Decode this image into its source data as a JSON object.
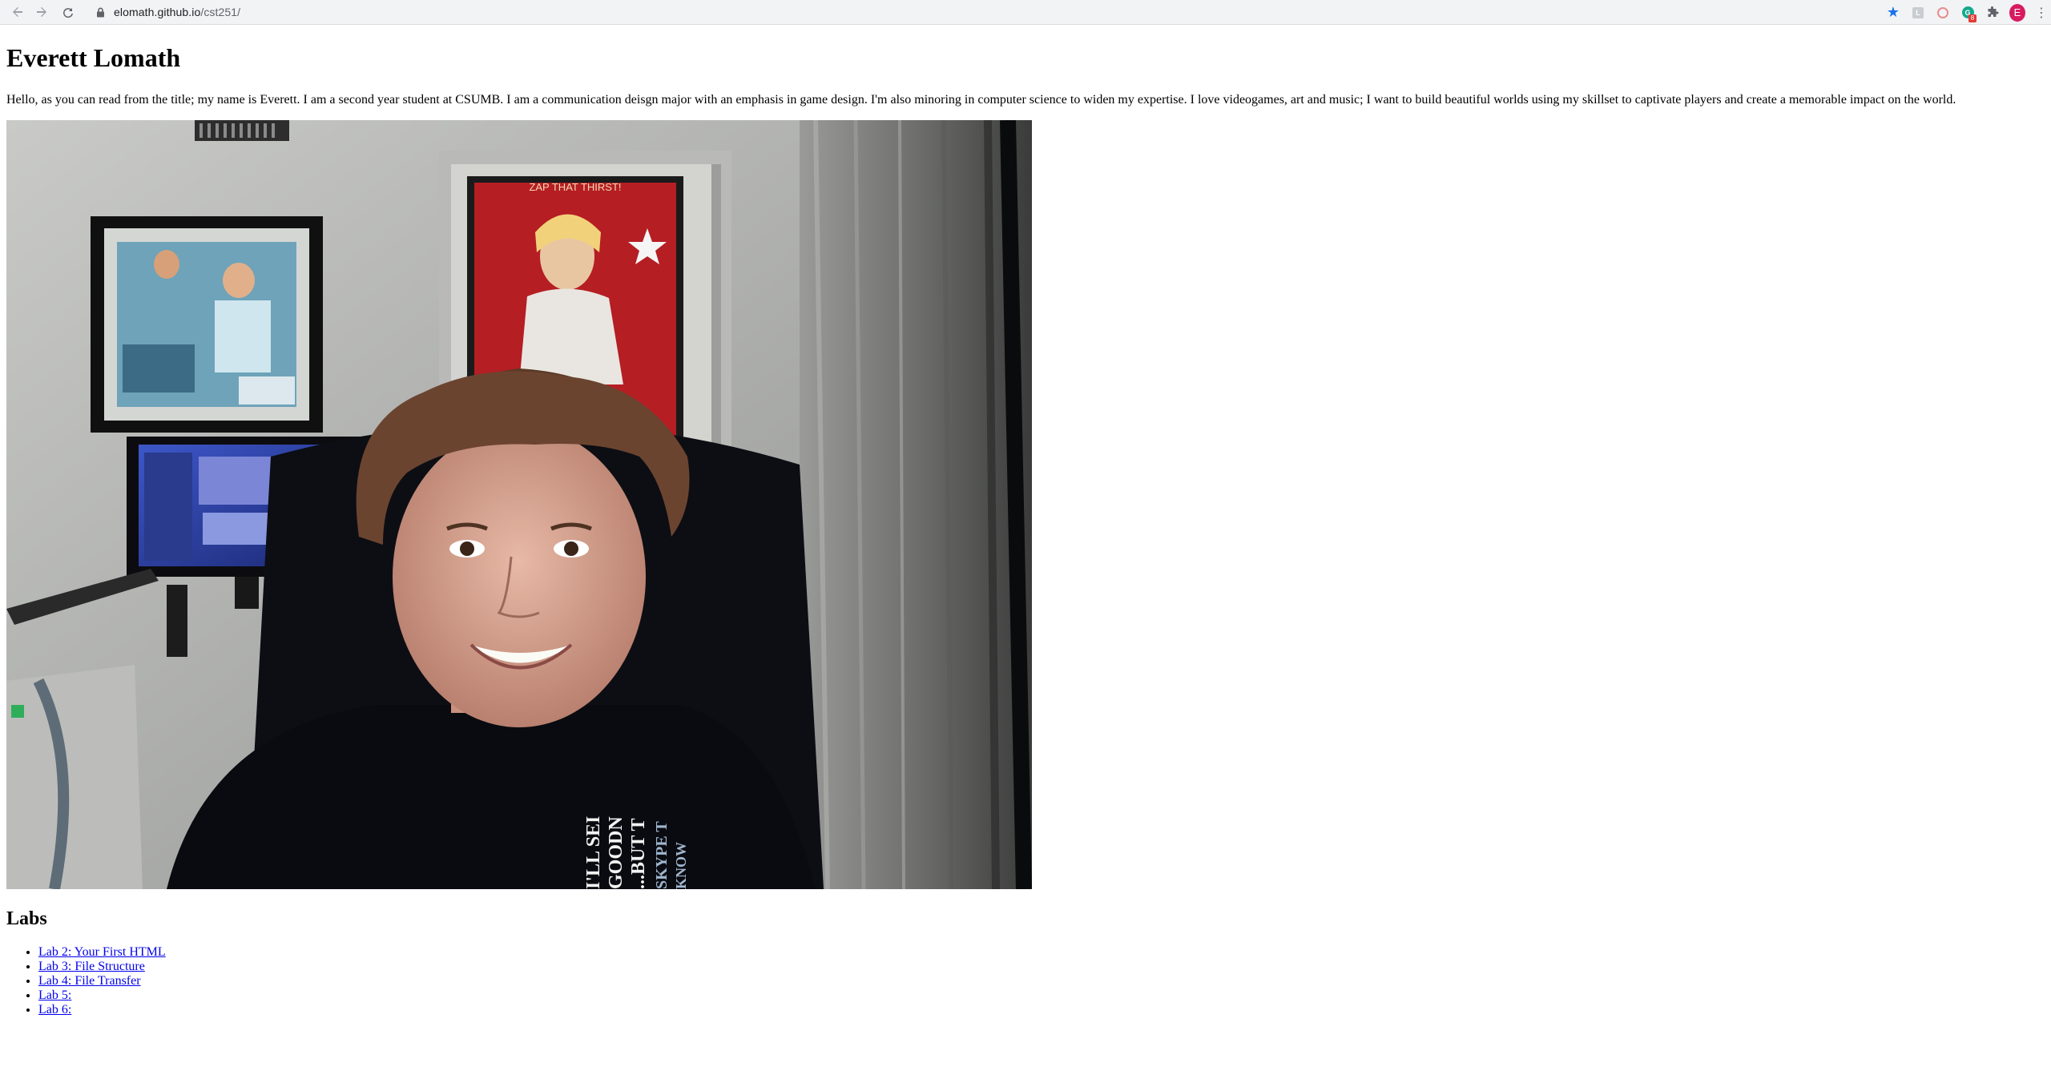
{
  "browser": {
    "url_host": "elomath.github.io",
    "url_path": "/cst251/",
    "profile_initial": "E",
    "extension_badge": "8",
    "extension_letter": "G",
    "extension_box_letter": "L",
    "icons": {
      "back": "arrow-left-icon",
      "forward": "arrow-right-icon",
      "reload": "reload-icon",
      "lock": "lock-icon",
      "bookmark": "star-icon",
      "extensions": "puzzle-icon",
      "menu": "kebab-menu-icon"
    },
    "colors": {
      "toolbar_bg": "#f1f3f4",
      "star": "#1a73e8",
      "avatar": "#d81b60",
      "badge": "#e53935",
      "grammarly": "#15a88c"
    }
  },
  "page": {
    "title": "Everett Lomath",
    "intro": "Hello, as you can read from the title; my name is Everett. I am a second year student at CSUMB. I am a communication deisgn major with an emphasis in game design. I'm also minoring in computer science to widen my expertise. I love videogames, art and music; I want to build beautiful worlds using my skillset to captivate players and create a memorable impact on the world.",
    "photo": {
      "poster_text": "ZAP THAT THIRST!",
      "shirt_text": [
        "I'LL SEI",
        "GOODN",
        "...BUT T",
        "SKYPE T",
        "KNOW"
      ]
    },
    "labs_heading": "Labs",
    "labs": [
      {
        "label": "Lab 2: Your First HTML"
      },
      {
        "label": "Lab 3: File Structure"
      },
      {
        "label": "Lab 4: File Transfer"
      },
      {
        "label": "Lab 5:"
      },
      {
        "label": "Lab 6:"
      }
    ],
    "link_color": "#0000ee"
  }
}
